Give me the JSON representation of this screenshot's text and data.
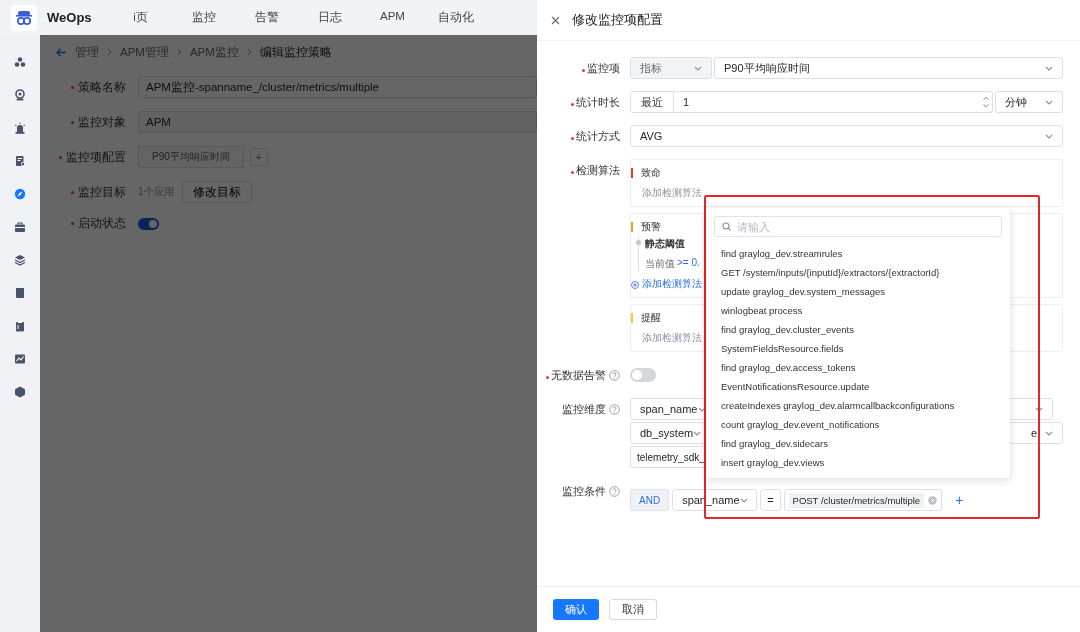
{
  "app": {
    "name": "WeOps"
  },
  "nav": [
    {
      "label": "i页"
    },
    {
      "label": "监控"
    },
    {
      "label": "告警"
    },
    {
      "label": "日志"
    },
    {
      "label": "APM"
    },
    {
      "label": "自动化"
    }
  ],
  "sidebar": {
    "items": [
      {
        "selected": false
      },
      {
        "selected": false
      },
      {
        "selected": false
      },
      {
        "selected": false
      },
      {
        "selected": true
      },
      {
        "selected": false
      },
      {
        "selected": false
      },
      {
        "selected": false
      },
      {
        "selected": false
      },
      {
        "selected": false
      },
      {
        "selected": false
      }
    ]
  },
  "breadcrumb": [
    "管理",
    "APM管理",
    "APM监控",
    "编辑监控策略"
  ],
  "policy_form": {
    "name": {
      "label": "策略名称",
      "value": "APM监控-spanname_/cluster/metrics/multiple"
    },
    "object": {
      "label": "监控对象",
      "value": "APM"
    },
    "metric_config": {
      "label": "监控项配置",
      "tag": "P90平均响应时间",
      "add": "+"
    },
    "target": {
      "label": "监控目标",
      "count": "1个应用",
      "button": "修改目标"
    },
    "enabled": {
      "label": "启动状态",
      "on": true
    }
  },
  "drawer": {
    "title": "修改监控项配置",
    "metric": {
      "label": "监控项",
      "type": "指标",
      "value": "P90平均响应时间"
    },
    "period": {
      "label": "统计时长",
      "prefix": "最近",
      "value": "1",
      "unit": "分钟"
    },
    "method": {
      "label": "统计方式",
      "value": "AVG"
    },
    "algorithms": {
      "label": "检测算法",
      "levels": [
        {
          "name": "致命",
          "color": "#e5393b",
          "add": "添加检测算法",
          "add_active": false
        },
        {
          "name": "预警",
          "color": "#f59a23",
          "rules": [
            {
              "name": "静态阈值",
              "prefix": "当前值",
              "condition": ">= 0."
            }
          ],
          "add": "添加检测算法",
          "add_active": true
        },
        {
          "name": "提醒",
          "color": "#f6c445",
          "add": "添加检测算法",
          "add_active": false
        }
      ]
    },
    "no_data_alarm": {
      "label": "无数据告警",
      "on": false
    },
    "dimensions": {
      "label": "监控维度",
      "rows": [
        {
          "key": "span_name"
        },
        {
          "key": "db_system",
          "value": "e"
        },
        {
          "key": "telemetry_sdk_"
        }
      ]
    },
    "conditions": {
      "label": "监控条件",
      "logic": "AND",
      "key": "span_name",
      "operator": "=",
      "value": "POST /cluster/metrics/multiple",
      "add": "+"
    },
    "confirm": "确认",
    "cancel": "取消"
  },
  "dropdown": {
    "placeholder": "请输入",
    "options": [
      "find graylog_dev.streamrules",
      "GET /system/inputs/{inputId}/extractors/{extractorId}",
      "update graylog_dev.system_messages",
      "winlogbeat process",
      "find graylog_dev.cluster_events",
      "SystemFieldsResource.fields",
      "find graylog_dev.access_tokens",
      "EventNotificationsResource.update",
      "createIndexes graylog_dev.alarmcallbackconfigurations",
      "count graylog_dev.event_notifications",
      "find graylog_dev.sidecars",
      "insert graylog_dev.views"
    ]
  }
}
